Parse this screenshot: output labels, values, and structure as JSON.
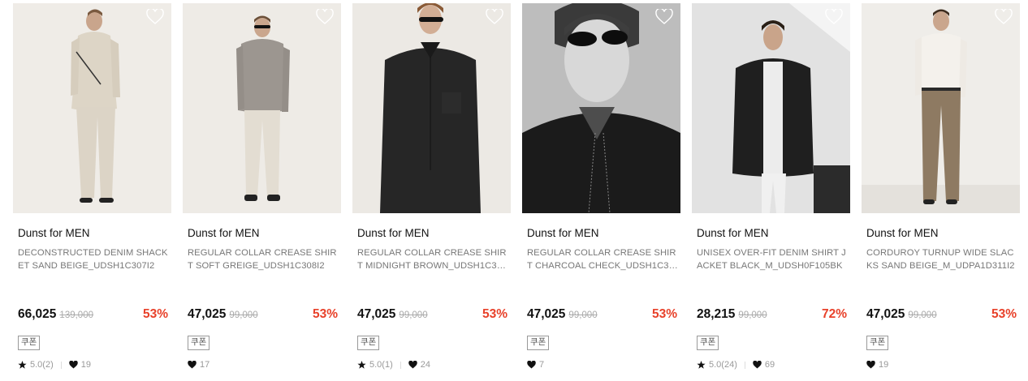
{
  "products": [
    {
      "brand": "Dunst for MEN",
      "name": "DECONSTRUCTED DENIM SHACKET SAND BEIGE_UDSH1C307I2",
      "price": "66,025",
      "original_price": "139,000",
      "discount": "53%",
      "coupon": "쿠폰",
      "rating": "5.0(2)",
      "likes": "19",
      "photo_bg": "#efece7"
    },
    {
      "brand": "Dunst for MEN",
      "name": "REGULAR COLLAR CREASE SHIRT SOFT GREIGE_UDSH1C308I2",
      "price": "47,025",
      "original_price": "99,000",
      "discount": "53%",
      "coupon": "쿠폰",
      "rating": "",
      "likes": "17",
      "photo_bg": "#eeebe6"
    },
    {
      "brand": "Dunst for MEN",
      "name": "REGULAR COLLAR CREASE SHIRT MIDNIGHT BROWN_UDSH1C308...",
      "price": "47,025",
      "original_price": "99,000",
      "discount": "53%",
      "coupon": "쿠폰",
      "rating": "5.0(1)",
      "likes": "24",
      "photo_bg": "#ece9e4"
    },
    {
      "brand": "Dunst for MEN",
      "name": "REGULAR COLLAR CREASE SHIRT CHARCOAL CHECK_UDSH1C309...",
      "price": "47,025",
      "original_price": "99,000",
      "discount": "53%",
      "coupon": "쿠폰",
      "rating": "",
      "likes": "7",
      "photo_bg": "#b9b9b9"
    },
    {
      "brand": "Dunst for MEN",
      "name": "UNISEX OVER-FIT DENIM SHIRT JACKET BLACK_M_UDSH0F105BK",
      "price": "28,215",
      "original_price": "99,000",
      "discount": "72%",
      "coupon": "쿠폰",
      "rating": "5.0(24)",
      "likes": "69",
      "photo_bg": "#dcdcdc"
    },
    {
      "brand": "Dunst for MEN",
      "name": "CORDUROY TURNUP WIDE SLACKS SAND BEIGE_M_UDPA1D311I2",
      "price": "47,025",
      "original_price": "99,000",
      "discount": "53%",
      "coupon": "쿠폰",
      "rating": "",
      "likes": "19",
      "photo_bg": "#efede9"
    }
  ],
  "colors": {
    "discount": "#e8412a",
    "price": "#111111",
    "name": "#777777",
    "meta": "#999999"
  },
  "icons": {
    "wishlist": "heart-outline-icon",
    "rating": "star-icon",
    "likes": "heart-filled-icon"
  }
}
